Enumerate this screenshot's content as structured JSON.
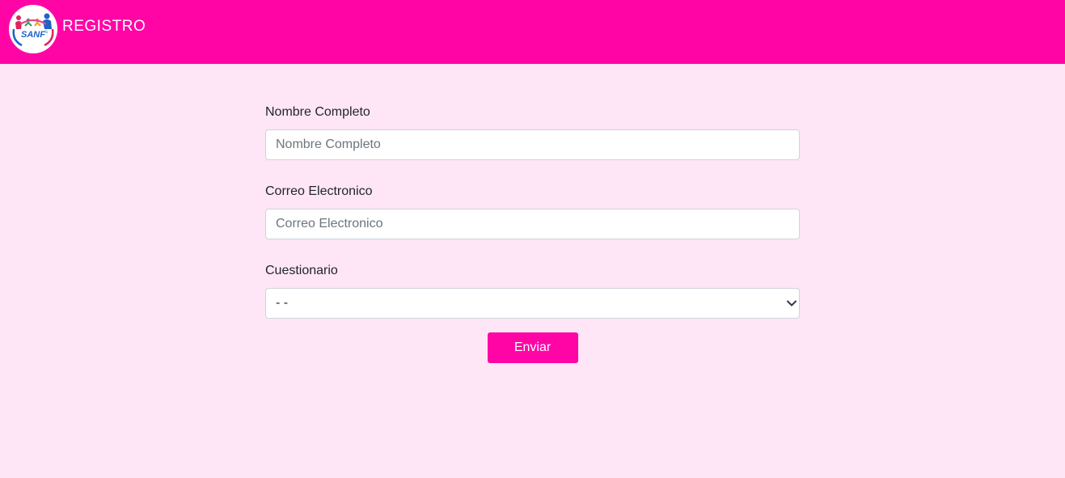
{
  "header": {
    "title": "REGISTRO",
    "logo_text": "SANF"
  },
  "form": {
    "name_label": "Nombre Completo",
    "name_placeholder": "Nombre Completo",
    "name_value": "",
    "email_label": "Correo Electronico",
    "email_placeholder": "Correo Electronico",
    "email_value": "",
    "survey_label": "Cuestionario",
    "survey_selected": "- -",
    "submit_label": "Enviar"
  },
  "colors": {
    "brand": "#ff05a6",
    "background": "#ffe6f7",
    "input_border": "#ced4da",
    "placeholder": "#6c757d"
  },
  "icons": {
    "logo": "sanf-logo-icon",
    "select": "chevron-down-icon"
  }
}
